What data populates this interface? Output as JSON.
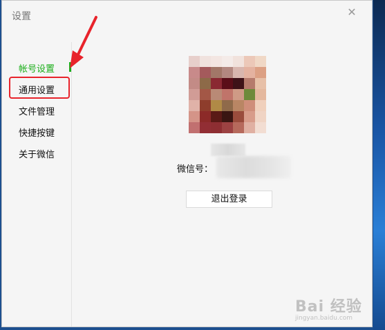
{
  "window": {
    "title": "设置",
    "close_icon": "✕"
  },
  "sidebar": {
    "items": [
      {
        "label": "帐号设置",
        "active": true
      },
      {
        "label": "通用设置",
        "active": false
      },
      {
        "label": "文件管理",
        "active": false
      },
      {
        "label": "快捷按键",
        "active": false
      },
      {
        "label": "关于微信",
        "active": false
      }
    ],
    "accent_color": "#1aad19"
  },
  "account": {
    "wechat_id_label": "微信号：",
    "logout_button": "退出登录"
  },
  "annotation": {
    "color": "#e8232b"
  },
  "watermark": {
    "main": "Bai 经验",
    "sub": "jingyan.baidu.com"
  }
}
